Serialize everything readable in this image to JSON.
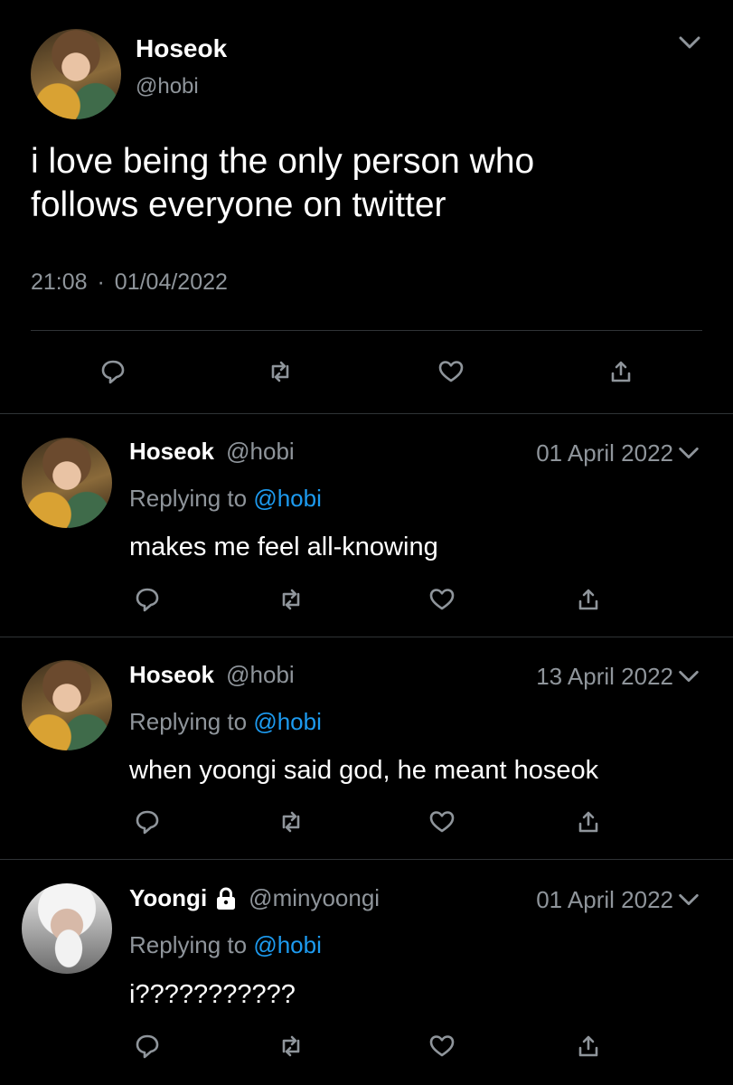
{
  "main_tweet": {
    "display_name": "Hoseok",
    "handle": "@hobi",
    "text_line1": "i love being the only person who",
    "text_line2": "follows everyone on twitter",
    "time": "21:08",
    "separator": "·",
    "date": "01/04/2022",
    "icons": [
      "reply-icon",
      "retweet-icon",
      "like-icon",
      "share-icon",
      "chevron-down-icon"
    ]
  },
  "replies": [
    {
      "display_name": "Hoseok",
      "handle": "@hobi",
      "date": "01 April 2022",
      "replying_prefix": "Replying to",
      "replying_to": "@hobi",
      "text": "makes me feel all-knowing"
    },
    {
      "display_name": "Hoseok",
      "handle": "@hobi",
      "date": "13 April 2022",
      "replying_prefix": "Replying to",
      "replying_to": "@hobi",
      "text": "when yoongi said god, he meant hoseok"
    },
    {
      "display_name": "Yoongi",
      "handle": "@minyoongi",
      "date": "01 April 2022",
      "replying_prefix": "Replying to",
      "replying_to": "@hobi",
      "text": "i???????????",
      "protected_icon": "lock-icon"
    }
  ],
  "colors": {
    "background": "#000000",
    "text": "#ffffff",
    "muted": "#8f959b",
    "link": "#1d9bf0",
    "divider": "#2f3336"
  }
}
